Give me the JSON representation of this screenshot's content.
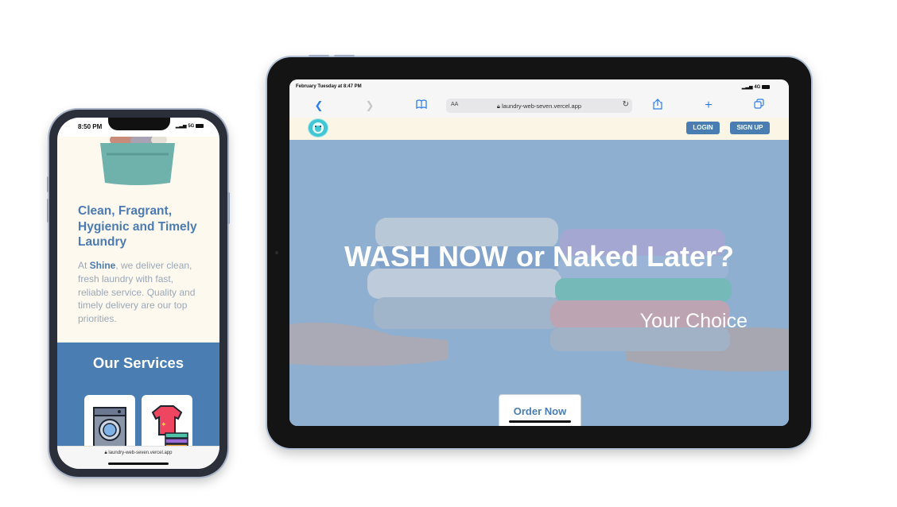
{
  "phone": {
    "status": {
      "time": "8:50 PM",
      "signal": "5G"
    },
    "headline": "Clean, Fragrant, Hygienic and Timely Laundry",
    "intro_prefix": "At ",
    "brand": "Shine",
    "intro_suffix": ", we deliver clean, fresh laundry with fast, reliable service. Quality and timely delivery are our top priorities.",
    "services_title": "Our Services",
    "services": [
      {
        "icon": "washing-machine-icon"
      },
      {
        "icon": "folded-clothes-icon"
      }
    ],
    "url": "laundry-web-seven.vercel.app"
  },
  "tablet": {
    "status": {
      "datetime": "February Tuesday at 8:47 PM",
      "signal": "4G"
    },
    "browser": {
      "text_size_label": "AA",
      "url": "laundry-web-seven.vercel.app"
    },
    "nav": {
      "login": "LOGIN",
      "signup": "SIGN UP"
    },
    "hero": {
      "headline": "WASH NOW or Naked Later?",
      "subheadline": "Your Choice",
      "cta": "Order Now"
    }
  },
  "colors": {
    "brand_blue": "#4a7eb3",
    "cream": "#fbf5e6",
    "hero_bg": "#8fb0d1",
    "logo_teal": "#43c6d3"
  }
}
